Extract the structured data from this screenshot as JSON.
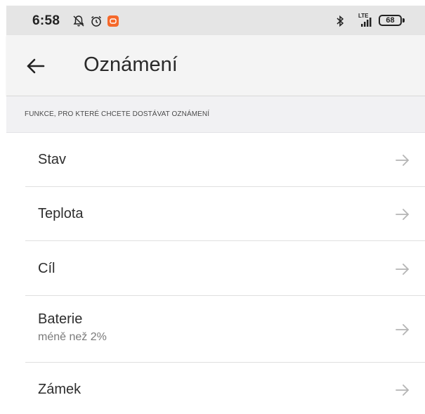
{
  "status_bar": {
    "time": "6:58",
    "lte_label": "LTE",
    "battery_level": "68",
    "icons": [
      "notifications-off-icon",
      "alarm-icon",
      "app-notification-icon",
      "bluetooth-icon",
      "signal-icon",
      "battery-icon"
    ],
    "app_icon_color": "#f5682a"
  },
  "app_bar": {
    "title": "Oznámení",
    "back_icon": "arrow-left-icon"
  },
  "section": {
    "header": "FUNKCE, PRO KTERÉ CHCETE DOSTÁVAT OZNÁMENÍ"
  },
  "items": [
    {
      "label": "Stav",
      "sublabel": ""
    },
    {
      "label": "Teplota",
      "sublabel": ""
    },
    {
      "label": "Cíl",
      "sublabel": ""
    },
    {
      "label": "Baterie",
      "sublabel": "méně než 2%"
    },
    {
      "label": "Zámek",
      "sublabel": ""
    }
  ],
  "colors": {
    "background": "#ffffff",
    "app_bar": "#f4f4f4",
    "section_header": "#f1f1f3",
    "arrow": "#b5b5b5"
  }
}
